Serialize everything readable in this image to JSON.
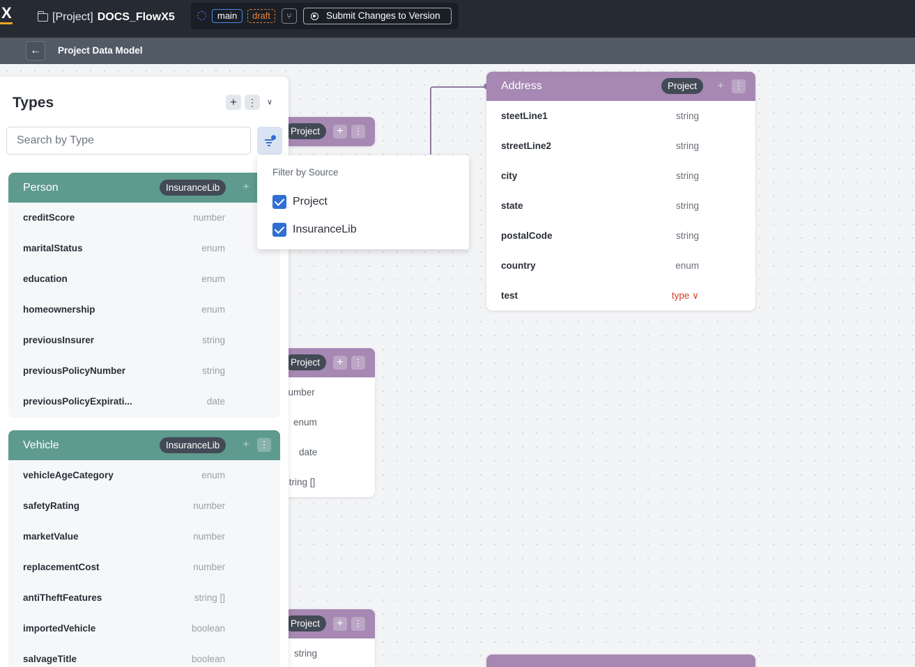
{
  "topbar": {
    "project_prefix": "[Project]",
    "project_name": "DOCS_FlowX5",
    "branch": "main",
    "status": "draft",
    "submit_label": "Submit Changes to Version"
  },
  "subheader": {
    "title": "Project Data Model"
  },
  "types_panel": {
    "title": "Types",
    "search_placeholder": "Search by Type",
    "types": [
      {
        "name": "Person",
        "source": "InsuranceLib",
        "fields": [
          {
            "name": "creditScore",
            "type": "number"
          },
          {
            "name": "maritalStatus",
            "type": "enum"
          },
          {
            "name": "education",
            "type": "enum"
          },
          {
            "name": "homeownership",
            "type": "enum"
          },
          {
            "name": "previousInsurer",
            "type": "string"
          },
          {
            "name": "previousPolicyNumber",
            "type": "string"
          },
          {
            "name": "previousPolicyExpirati...",
            "type": "date"
          }
        ]
      },
      {
        "name": "Vehicle",
        "source": "InsuranceLib",
        "fields": [
          {
            "name": "vehicleAgeCategory",
            "type": "enum"
          },
          {
            "name": "safetyRating",
            "type": "number"
          },
          {
            "name": "marketValue",
            "type": "number"
          },
          {
            "name": "replacementCost",
            "type": "number"
          },
          {
            "name": "antiTheftFeatures",
            "type": "string []"
          },
          {
            "name": "importedVehicle",
            "type": "boolean"
          },
          {
            "name": "salvageTitle",
            "type": "boolean"
          }
        ]
      }
    ]
  },
  "filter_popover": {
    "title": "Filter by Source",
    "options": [
      {
        "label": "Project",
        "checked": true
      },
      {
        "label": "InsuranceLib",
        "checked": true
      }
    ]
  },
  "canvas": {
    "address_card": {
      "title": "Address",
      "source": "Project",
      "fields": [
        {
          "name": "steetLine1",
          "type": "string"
        },
        {
          "name": "streetLine2",
          "type": "string"
        },
        {
          "name": "city",
          "type": "string"
        },
        {
          "name": "state",
          "type": "string"
        },
        {
          "name": "postalCode",
          "type": "string"
        },
        {
          "name": "country",
          "type": "enum"
        },
        {
          "name": "test",
          "type": "type ∨"
        }
      ]
    },
    "stub_cards": [
      {
        "source": "Project",
        "types": []
      },
      {
        "source": "Project",
        "types": [
          "number",
          "enum",
          "date",
          "string []"
        ]
      },
      {
        "source": "Project",
        "types": [
          "string"
        ]
      }
    ]
  },
  "colors": {
    "project_header": "#a688b3",
    "library_header": "#5f9a8e",
    "topbar": "#252a33",
    "accent": "#2f6fd4"
  }
}
